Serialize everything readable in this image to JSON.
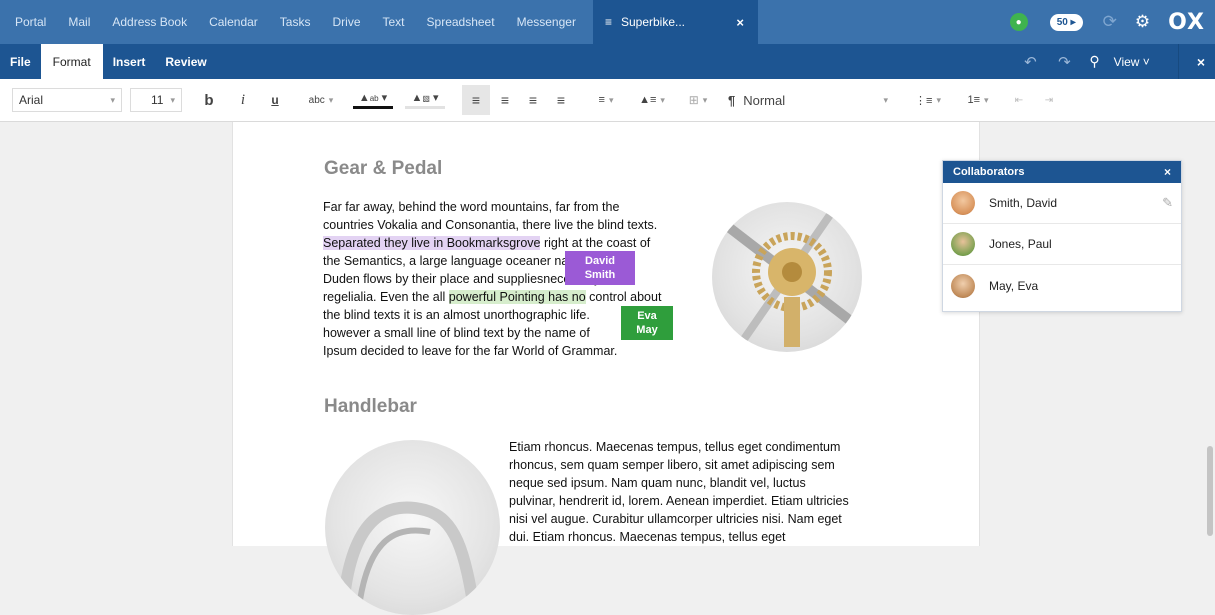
{
  "topnav": {
    "apps": [
      "Portal",
      "Mail",
      "Address Book",
      "Calendar",
      "Tasks",
      "Drive",
      "Text",
      "Spreadsheet",
      "Messenger"
    ],
    "doc_tab": {
      "icon": "document-icon",
      "label": "Superbike..."
    },
    "badge": "50 ▸",
    "logo": "OX"
  },
  "menubar": {
    "items": [
      "File",
      "Format",
      "Insert",
      "Review"
    ],
    "active": "Format",
    "view_label": "View ˅"
  },
  "toolbar": {
    "font": "Arial",
    "size": "11",
    "bold": "b",
    "italic": "i",
    "underline": "u",
    "strike": "abc",
    "paragraph_style": "Normal",
    "paragraph_glyph": "¶"
  },
  "document": {
    "section1_title": "Gear & Pedal",
    "section1_lines": [
      {
        "before": "Far far away, behind the word mountains, far from the",
        "hl": "",
        "after": ""
      },
      {
        "before": "countries Vokalia and Consonantia, there live the blind texts.",
        "hl": "",
        "after": ""
      },
      {
        "before": "",
        "hl": "Separated they live in Bookmarksgrove",
        "after": " right at the coast of",
        "color": "purple"
      },
      {
        "before": "the Semantics, a large language ocean",
        "hl": "",
        "after": "er named"
      },
      {
        "before": "Duden flows by their place and supplies",
        "hl": "",
        "after": "necessary"
      },
      {
        "before": "regelialia. Even the all ",
        "hl": "powerful Pointing has no",
        "after": " control about",
        "color": "green"
      },
      {
        "before": "the blind texts it is an almost unorthographic life.",
        "hl": "",
        "after": ""
      },
      {
        "before": "however a small line of blind text by the name of",
        "hl": "",
        "after": ""
      },
      {
        "before": "Ipsum decided to leave for the far World of Grammar.",
        "hl": "",
        "after": ""
      }
    ],
    "cursor_david": "David Smith",
    "cursor_eva": "Eva May",
    "section2_title": "Handlebar",
    "section2_lines": [
      "Etiam rhoncus. Maecenas tempus, tellus eget condimentum",
      "rhoncus, sem quam semper libero, sit amet adipiscing sem",
      "neque sed ipsum. Nam quam nunc, blandit vel, luctus",
      "pulvinar, hendrerit id, lorem. Aenean imperdiet. Etiam ultricies",
      "nisi vel augue. Curabitur ullamcorper ultricies nisi. Nam eget",
      "dui. Etiam rhoncus. Maecenas tempus, tellus eget"
    ]
  },
  "collaborators": {
    "title": "Collaborators",
    "people": [
      {
        "name": "Smith, David",
        "avatar_color": "#e3a36b"
      },
      {
        "name": "Jones, Paul",
        "avatar_color": "#5a8a3c"
      },
      {
        "name": "May, Eva",
        "avatar_color": "#b07a4a"
      }
    ]
  },
  "colors": {
    "nav_blue": "#3b72ac",
    "dark_blue": "#1d5592",
    "purple_highlight": "#e3d3f3",
    "purple_tag": "#9b5ad6",
    "green_highlight": "#d6edcc",
    "green_tag": "#2f9e3c"
  }
}
